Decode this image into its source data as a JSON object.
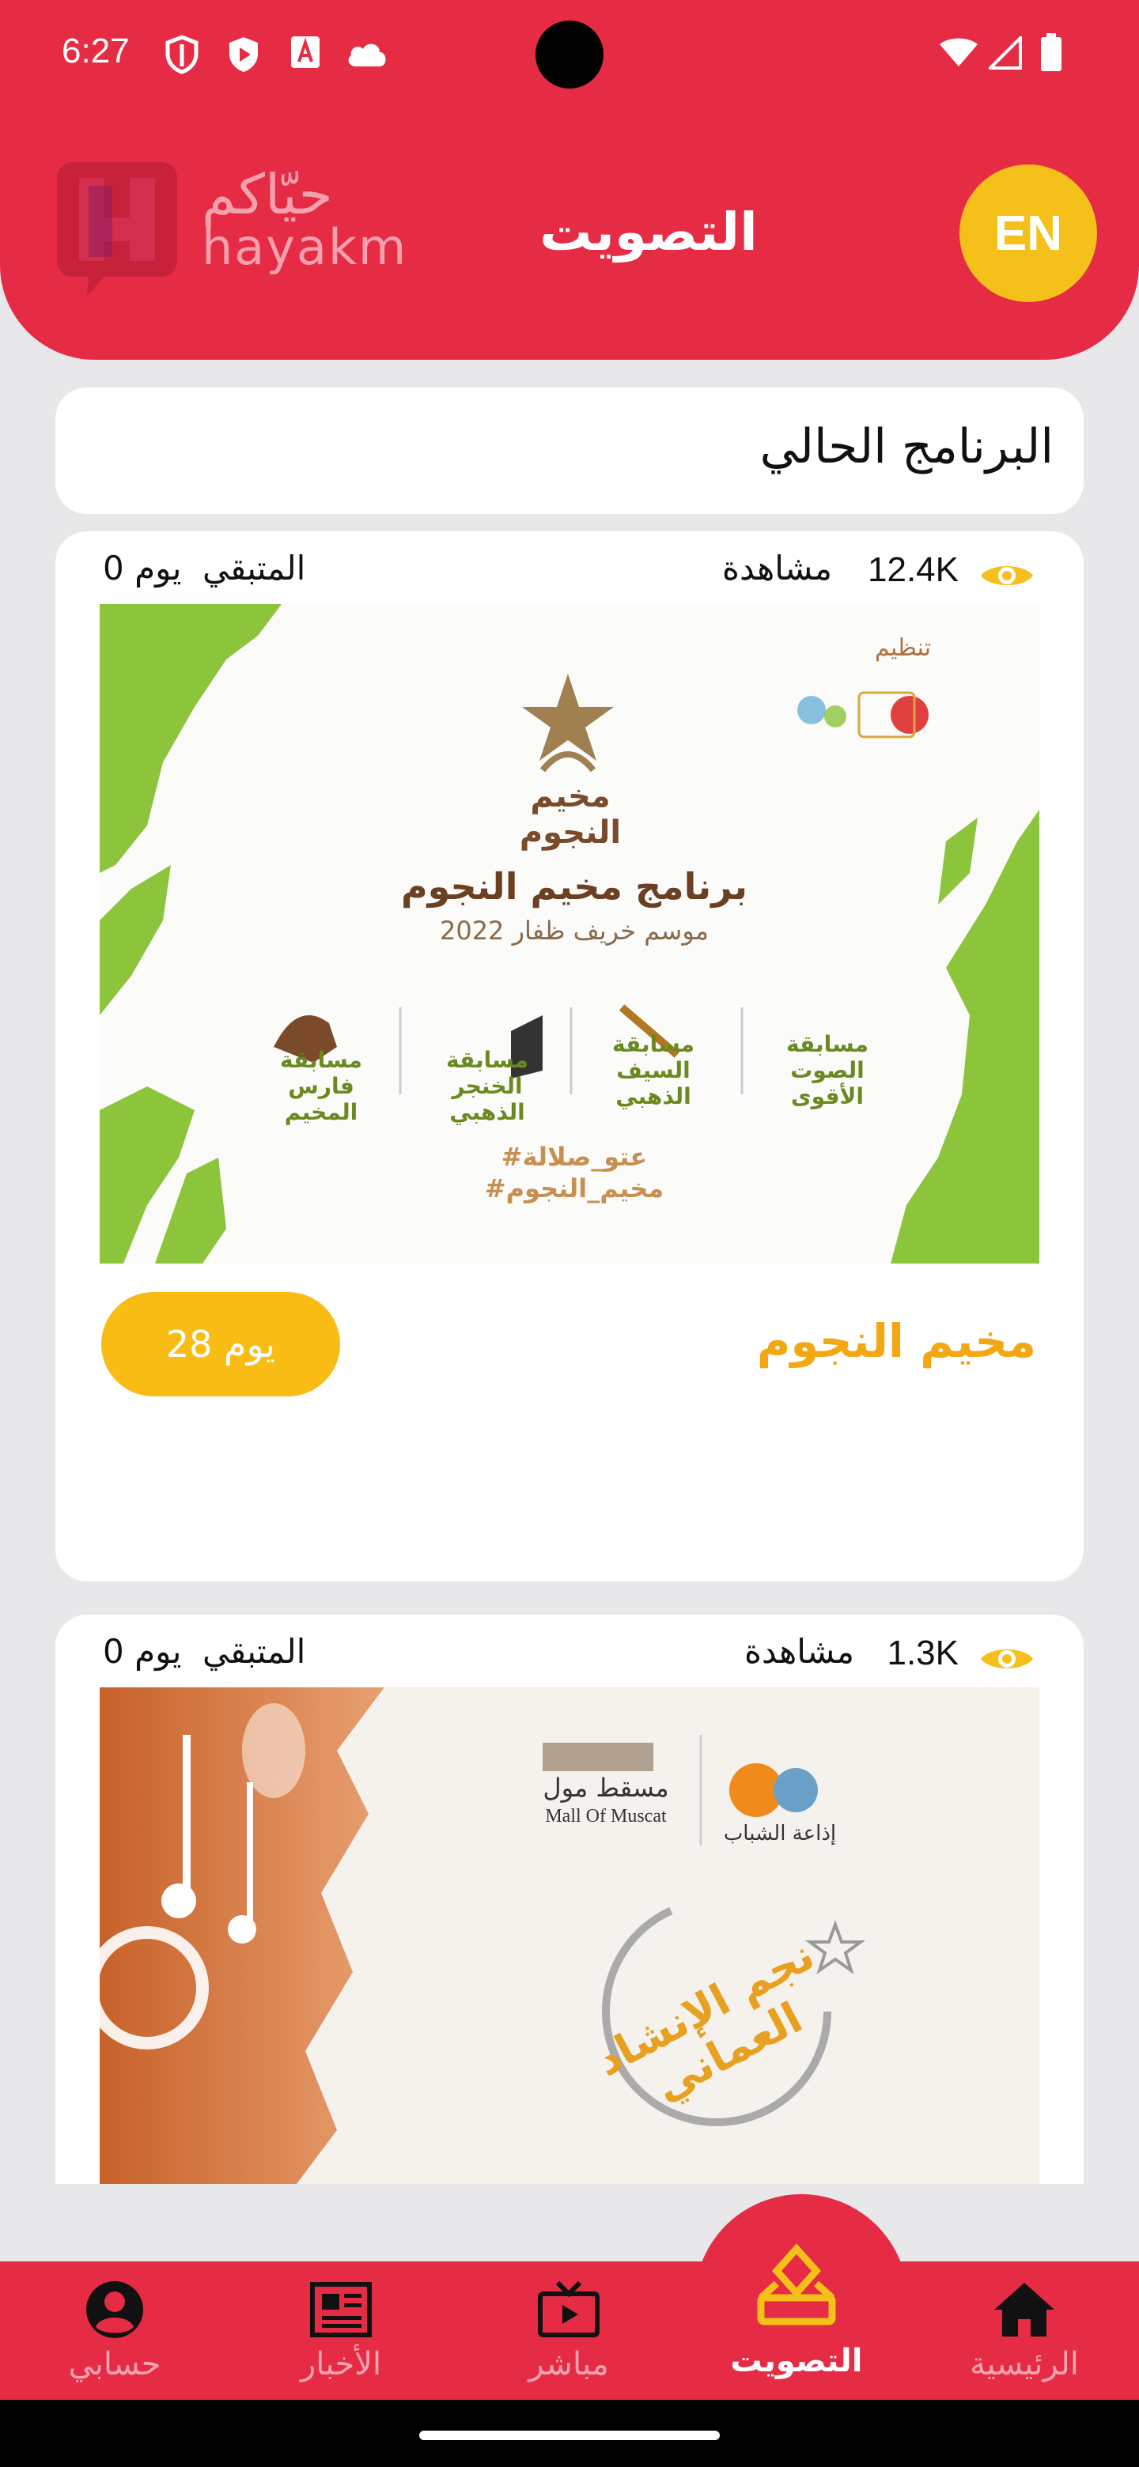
{
  "status_bar": {
    "time": "6:27"
  },
  "header": {
    "logo_ar": "حيّاكم",
    "logo_en": "hayakm",
    "title": "التصويت",
    "language_button": "EN"
  },
  "current_program_label": "البرنامج الحالي",
  "cards": [
    {
      "views": "12.4K",
      "views_label": "مشاهدة",
      "remaining_label": "المتبقي",
      "remaining_value": "0 يوم",
      "banner": {
        "organizer": "تنظيم",
        "star_title": "مخيم النجوم",
        "headline": "برنامج مخيم النجوم",
        "season": "موسم خريف ظفار 2022",
        "competitions": [
          "مسابقة الصوت الأقوى",
          "مسابقة السيف الذهبي",
          "مسابقة الخنجر الذهبي",
          "مسابقة فارس المخيم"
        ],
        "hashtag1": "#عتو_صلالة",
        "hashtag2": "#مخيم_النجوم"
      },
      "title": "مخيم النجوم",
      "days_button": "28 يوم"
    },
    {
      "views": "1.3K",
      "views_label": "مشاهدة",
      "remaining_label": "المتبقي",
      "remaining_value": "0 يوم",
      "banner": {
        "mall_ar": "مسقط مول",
        "mall_en": "Mall Of Muscat",
        "radio": "إذاعة الشباب",
        "calligraphy": "نجم الإنشاد العماني"
      }
    }
  ],
  "bottom_nav": [
    {
      "label": "حسابي",
      "icon": "account-icon"
    },
    {
      "label": "الأخبار",
      "icon": "news-icon"
    },
    {
      "label": "مباشر",
      "icon": "live-tv-icon"
    },
    {
      "label": "التصويت",
      "icon": "vote-icon",
      "active": true
    },
    {
      "label": "الرئيسية",
      "icon": "home-icon"
    }
  ],
  "colors": {
    "primary": "#e62b45",
    "accent": "#f4c019",
    "title_orange": "#f2a713"
  }
}
